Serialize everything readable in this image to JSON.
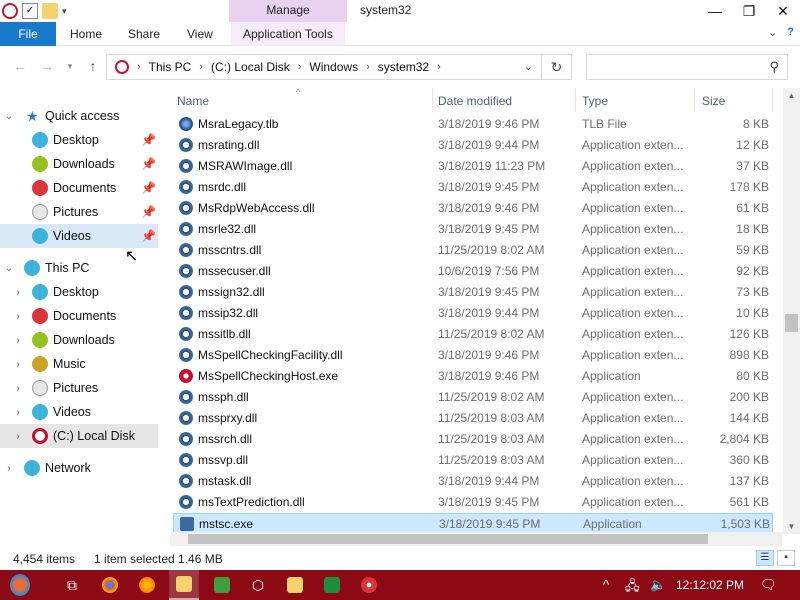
{
  "window": {
    "title": "system32",
    "context_tab": "Manage",
    "controls": [
      "minimize",
      "maximize",
      "close"
    ]
  },
  "ribbon": {
    "tabs": [
      "File",
      "Home",
      "Share",
      "View",
      "Application Tools"
    ]
  },
  "address": {
    "breadcrumbs": [
      "This PC",
      "(C:) Local Disk",
      "Windows",
      "system32"
    ],
    "search_placeholder": ""
  },
  "nav": {
    "quick_access": "Quick access",
    "quick_items": [
      "Desktop",
      "Downloads",
      "Documents",
      "Pictures",
      "Videos"
    ],
    "this_pc": "This PC",
    "pc_items": [
      "Desktop",
      "Documents",
      "Downloads",
      "Music",
      "Pictures",
      "Videos",
      "(C:) Local Disk"
    ],
    "network": "Network"
  },
  "columns": {
    "name": "Name",
    "date": "Date modified",
    "type": "Type",
    "size": "Size"
  },
  "files": [
    {
      "name": "MsraLegacy.tlb",
      "date": "3/18/2019 9:46 PM",
      "type": "TLB File",
      "size": "8 KB",
      "icon": "tlb-icon"
    },
    {
      "name": "msrating.dll",
      "date": "3/18/2019 9:44 PM",
      "type": "Application exten...",
      "size": "12 KB",
      "icon": "dll-icon"
    },
    {
      "name": "MSRAWImage.dll",
      "date": "3/18/2019 11:23 PM",
      "type": "Application exten...",
      "size": "37 KB",
      "icon": "dll-icon"
    },
    {
      "name": "msrdc.dll",
      "date": "3/18/2019 9:45 PM",
      "type": "Application exten...",
      "size": "178 KB",
      "icon": "dll-icon"
    },
    {
      "name": "MsRdpWebAccess.dll",
      "date": "3/18/2019 9:46 PM",
      "type": "Application exten...",
      "size": "61 KB",
      "icon": "dll-icon"
    },
    {
      "name": "msrle32.dll",
      "date": "3/18/2019 9:45 PM",
      "type": "Application exten...",
      "size": "18 KB",
      "icon": "dll-icon"
    },
    {
      "name": "msscntrs.dll",
      "date": "11/25/2019 8:02 AM",
      "type": "Application exten...",
      "size": "59 KB",
      "icon": "dll-icon"
    },
    {
      "name": "mssecuser.dll",
      "date": "10/6/2019 7:56 PM",
      "type": "Application exten...",
      "size": "92 KB",
      "icon": "dll-icon"
    },
    {
      "name": "mssign32.dll",
      "date": "3/18/2019 9:45 PM",
      "type": "Application exten...",
      "size": "73 KB",
      "icon": "dll-icon"
    },
    {
      "name": "mssip32.dll",
      "date": "3/18/2019 9:44 PM",
      "type": "Application exten...",
      "size": "10 KB",
      "icon": "dll-icon"
    },
    {
      "name": "mssitlb.dll",
      "date": "11/25/2019 8:02 AM",
      "type": "Application exten...",
      "size": "126 KB",
      "icon": "dll-icon"
    },
    {
      "name": "MsSpellCheckingFacility.dll",
      "date": "3/18/2019 9:46 PM",
      "type": "Application exten...",
      "size": "898 KB",
      "icon": "dll-icon"
    },
    {
      "name": "MsSpellCheckingHost.exe",
      "date": "3/18/2019 9:46 PM",
      "type": "Application",
      "size": "80 KB",
      "icon": "exe-icon"
    },
    {
      "name": "mssph.dll",
      "date": "11/25/2019 8:02 AM",
      "type": "Application exten...",
      "size": "200 KB",
      "icon": "dll-icon"
    },
    {
      "name": "mssprxy.dll",
      "date": "11/25/2019 8:03 AM",
      "type": "Application exten...",
      "size": "144 KB",
      "icon": "dll-icon"
    },
    {
      "name": "mssrch.dll",
      "date": "11/25/2019 8:03 AM",
      "type": "Application exten...",
      "size": "2,804 KB",
      "icon": "dll-icon"
    },
    {
      "name": "mssvp.dll",
      "date": "11/25/2019 8:03 AM",
      "type": "Application exten...",
      "size": "360 KB",
      "icon": "dll-icon"
    },
    {
      "name": "mstask.dll",
      "date": "3/18/2019 9:44 PM",
      "type": "Application exten...",
      "size": "137 KB",
      "icon": "dll-icon"
    },
    {
      "name": "msTextPrediction.dll",
      "date": "3/18/2019 9:45 PM",
      "type": "Application exten...",
      "size": "561 KB",
      "icon": "dll-icon"
    },
    {
      "name": "mstsc.exe",
      "date": "3/18/2019 9:45 PM",
      "type": "Application",
      "size": "1,503 KB",
      "icon": "rdp-icon",
      "selected": true
    }
  ],
  "status": {
    "count": "4,454 items",
    "selection": "1 item selected  1.46 MB"
  },
  "taskbar": {
    "clock": "12:12:02 PM",
    "colors": {
      "bar": "#8b0a15"
    }
  }
}
